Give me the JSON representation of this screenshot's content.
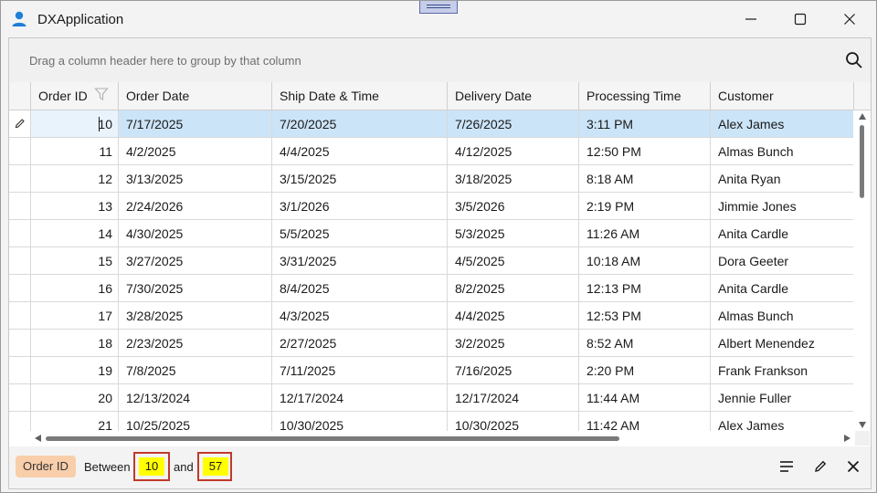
{
  "window": {
    "title": "DXApplication"
  },
  "group_panel": {
    "placeholder": "Drag a column header here to group by that column"
  },
  "columns": [
    "Order ID",
    "Order Date",
    "Ship Date & Time",
    "Delivery Date",
    "Processing Time",
    "Customer"
  ],
  "rows": [
    [
      "10",
      "7/17/2025",
      "7/20/2025",
      "7/26/2025",
      "3:11 PM",
      "Alex James"
    ],
    [
      "11",
      "4/2/2025",
      "4/4/2025",
      "4/12/2025",
      "12:50 PM",
      "Almas Bunch"
    ],
    [
      "12",
      "3/13/2025",
      "3/15/2025",
      "3/18/2025",
      "8:18 AM",
      "Anita Ryan"
    ],
    [
      "13",
      "2/24/2026",
      "3/1/2026",
      "3/5/2026",
      "2:19 PM",
      "Jimmie Jones"
    ],
    [
      "14",
      "4/30/2025",
      "5/5/2025",
      "5/3/2025",
      "11:26 AM",
      "Anita Cardle"
    ],
    [
      "15",
      "3/27/2025",
      "3/31/2025",
      "4/5/2025",
      "10:18 AM",
      "Dora Geeter"
    ],
    [
      "16",
      "7/30/2025",
      "8/4/2025",
      "8/2/2025",
      "12:13 PM",
      "Anita Cardle"
    ],
    [
      "17",
      "3/28/2025",
      "4/3/2025",
      "4/4/2025",
      "12:53 PM",
      "Almas Bunch"
    ],
    [
      "18",
      "2/23/2025",
      "2/27/2025",
      "3/2/2025",
      "8:52 AM",
      "Albert Menendez"
    ],
    [
      "19",
      "7/8/2025",
      "7/11/2025",
      "7/16/2025",
      "2:20 PM",
      "Frank Frankson"
    ],
    [
      "20",
      "12/13/2024",
      "12/17/2024",
      "12/17/2024",
      "11:44 AM",
      "Jennie Fuller"
    ],
    [
      "21",
      "10/25/2025",
      "10/30/2025",
      "10/30/2025",
      "11:42 AM",
      "Alex James"
    ]
  ],
  "filter_panel": {
    "field": "Order ID",
    "operator": "Between",
    "value1": "10",
    "conjunction": "and",
    "value2": "57"
  },
  "colors": {
    "focused_row": "#cce4f7",
    "filter_field_bg": "#f9ceaa",
    "filter_value_bg": "#ffff00",
    "filter_value_border": "#c0392b"
  }
}
